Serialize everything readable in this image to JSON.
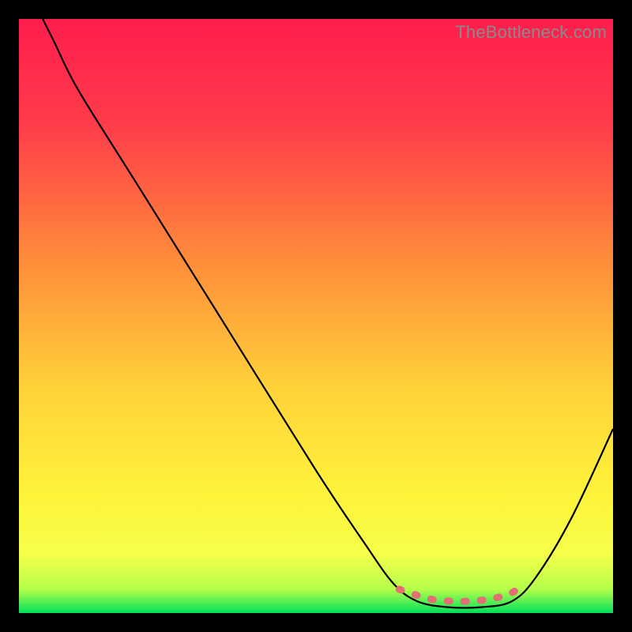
{
  "watermark": "TheBottleneck.com",
  "chart_data": {
    "type": "line",
    "title": "",
    "xlabel": "",
    "ylabel": "",
    "xlim": [
      0,
      100
    ],
    "ylim": [
      0,
      100
    ],
    "gradient_stops": [
      {
        "offset": 0,
        "color": "#ff1d4d"
      },
      {
        "offset": 18,
        "color": "#ff3c4a"
      },
      {
        "offset": 40,
        "color": "#ff8a3a"
      },
      {
        "offset": 62,
        "color": "#ffd23a"
      },
      {
        "offset": 80,
        "color": "#fff33a"
      },
      {
        "offset": 90,
        "color": "#f6ff4a"
      },
      {
        "offset": 96,
        "color": "#b6ff4a"
      },
      {
        "offset": 100,
        "color": "#00e05a"
      }
    ],
    "series": [
      {
        "name": "bottleneck-curve",
        "color": "#000000",
        "points": [
          {
            "x": 4,
            "y": 100
          },
          {
            "x": 6,
            "y": 96
          },
          {
            "x": 10,
            "y": 88
          },
          {
            "x": 20,
            "y": 72
          },
          {
            "x": 35,
            "y": 48
          },
          {
            "x": 50,
            "y": 24
          },
          {
            "x": 58,
            "y": 12
          },
          {
            "x": 63,
            "y": 5
          },
          {
            "x": 67,
            "y": 2
          },
          {
            "x": 72,
            "y": 1
          },
          {
            "x": 78,
            "y": 1
          },
          {
            "x": 83,
            "y": 2
          },
          {
            "x": 87,
            "y": 6
          },
          {
            "x": 93,
            "y": 16
          },
          {
            "x": 100,
            "y": 31
          }
        ]
      },
      {
        "name": "highlight-band",
        "color": "#e26f73",
        "points": [
          {
            "x": 64,
            "y": 4
          },
          {
            "x": 67,
            "y": 3
          },
          {
            "x": 70,
            "y": 2.2
          },
          {
            "x": 73,
            "y": 2
          },
          {
            "x": 76,
            "y": 2
          },
          {
            "x": 79,
            "y": 2.3
          },
          {
            "x": 82,
            "y": 3
          },
          {
            "x": 84,
            "y": 4
          }
        ]
      }
    ]
  }
}
